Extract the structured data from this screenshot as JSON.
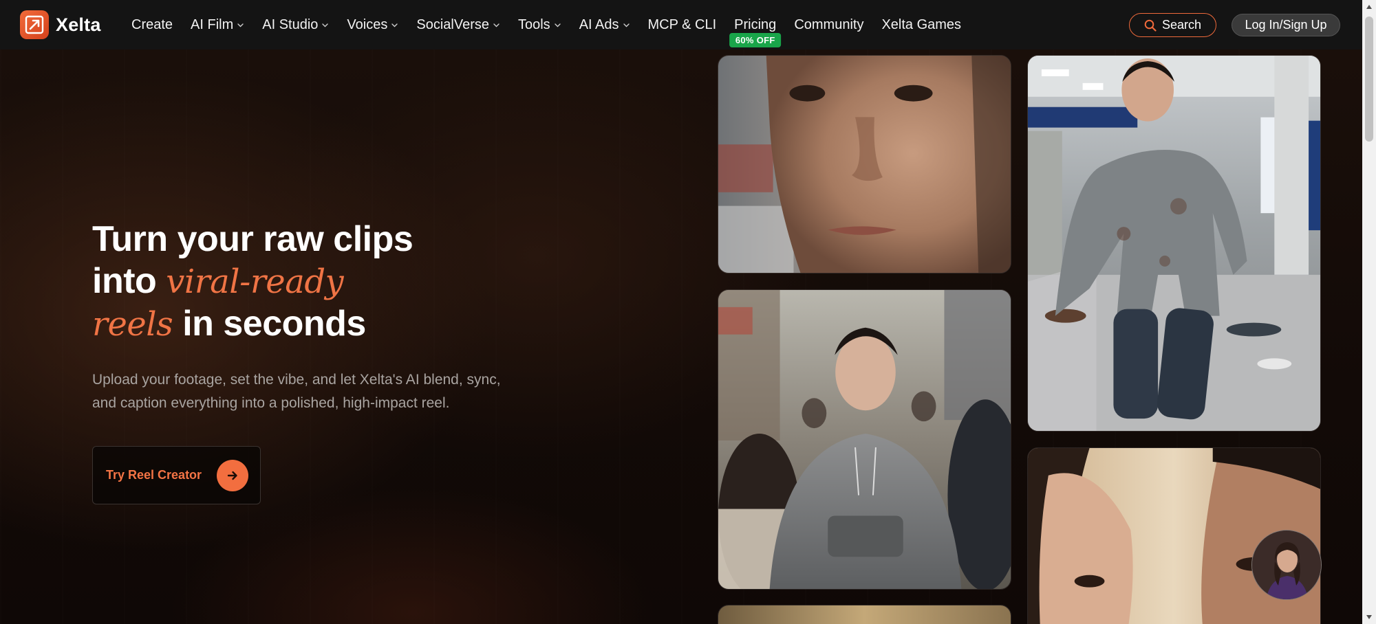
{
  "brand": {
    "name": "Xelta",
    "accent": "#f26e3f"
  },
  "nav": {
    "items": [
      {
        "label": "Create",
        "dropdown": false
      },
      {
        "label": "AI Film",
        "dropdown": true
      },
      {
        "label": "AI Studio",
        "dropdown": true
      },
      {
        "label": "Voices",
        "dropdown": true
      },
      {
        "label": "SocialVerse",
        "dropdown": true
      },
      {
        "label": "Tools",
        "dropdown": true
      },
      {
        "label": "AI Ads",
        "dropdown": true
      },
      {
        "label": "MCP & CLI",
        "dropdown": false
      },
      {
        "label": "Pricing",
        "dropdown": false,
        "badge": "60% OFF"
      },
      {
        "label": "Community",
        "dropdown": false
      },
      {
        "label": "Xelta Games",
        "dropdown": false
      }
    ],
    "search_label": "Search",
    "login_label": "Log In/Sign Up"
  },
  "hero": {
    "line1": "Turn your raw clips",
    "line2_plain": "into ",
    "line2_accent": "viral-ready",
    "line3_accent": "reels",
    "line3_plain": " in seconds",
    "subtext_line1": "Upload your footage, set the vibe, and let Xelta's AI blend, sync,",
    "subtext_line2": "and caption everything into a polished, high-impact reel.",
    "cta_label": "Try Reel Creator"
  },
  "icons": {
    "logo": "xelta-logo-icon",
    "search": "search-icon",
    "chevron": "chevron-down-icon",
    "cta": "arrow-right-icon"
  }
}
